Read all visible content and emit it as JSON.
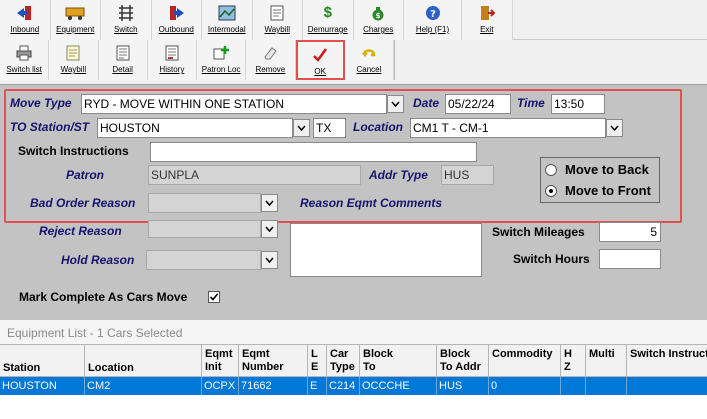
{
  "toolbar1": {
    "buttons": [
      {
        "label": "Inbound",
        "icon": "inbound-icon"
      },
      {
        "label": "Equipment",
        "icon": "equipment-icon"
      },
      {
        "label": "Switch",
        "icon": "switch-icon"
      },
      {
        "label": "Outbound",
        "icon": "outbound-icon"
      },
      {
        "label": "Intermodal",
        "icon": "intermodal-icon"
      },
      {
        "label": "Waybill",
        "icon": "waybill-icon"
      },
      {
        "label": "Demurrage",
        "icon": "dollar-icon"
      },
      {
        "label": "Charges",
        "icon": "money-bag-icon"
      },
      {
        "label": "Help (F1)",
        "icon": "help-icon"
      },
      {
        "label": "Exit",
        "icon": "exit-icon"
      }
    ]
  },
  "toolbar2": {
    "buttons": [
      {
        "label": "Switch list",
        "icon": "printer-icon"
      },
      {
        "label": "Waybill",
        "icon": "waybill-icon"
      },
      {
        "label": "Detail",
        "icon": "detail-icon"
      },
      {
        "label": "History",
        "icon": "history-icon"
      },
      {
        "label": "Patron Loc",
        "icon": "patron-loc-icon"
      },
      {
        "label": "Remove",
        "icon": "eraser-icon"
      },
      {
        "label": "OK",
        "icon": "checkmark-icon"
      },
      {
        "label": "Cancel",
        "icon": "cancel-icon"
      }
    ]
  },
  "form": {
    "move_type_label": "Move Type",
    "move_type_value": "RYD - MOVE WITHIN ONE STATION",
    "date_label": "Date",
    "date_value": "05/22/24",
    "time_label": "Time",
    "time_value": "13:50",
    "to_station_label": "TO Station/ST",
    "to_station_value": "HOUSTON",
    "state_value": "TX",
    "location_label": "Location",
    "location_value": "CM1 T - CM-1",
    "switch_instructions_label": "Switch Instructions",
    "switch_instructions_value": "",
    "patron_label": "Patron",
    "patron_value": "SUNPLA",
    "addr_type_label": "Addr Type",
    "addr_type_value": "HUS",
    "bad_order_reason_label": "Bad Order Reason",
    "reason_eqmt_comments_label": "Reason Eqmt Comments",
    "reject_reason_label": "Reject Reason",
    "hold_reason_label": "Hold Reason",
    "move_to_back_label": "Move to Back",
    "move_to_front_label": "Move to Front",
    "move_selected": "front",
    "switch_mileages_label": "Switch Mileages",
    "switch_mileages_value": "5",
    "switch_hours_label": "Switch Hours",
    "switch_hours_value": "",
    "mark_complete_label": "Mark Complete As Cars Move",
    "mark_complete_checked": true
  },
  "equipment_list": {
    "title": "Equipment List - 1 Cars Selected",
    "columns": [
      {
        "l1": "",
        "l2": "Station"
      },
      {
        "l1": "",
        "l2": "Location"
      },
      {
        "l1": "Eqmt",
        "l2": "Init"
      },
      {
        "l1": "Eqmt",
        "l2": "Number"
      },
      {
        "l1": "L",
        "l2": "E"
      },
      {
        "l1": "Car",
        "l2": "Type"
      },
      {
        "l1": "Block",
        "l2": "To"
      },
      {
        "l1": "Block",
        "l2": "To Addr"
      },
      {
        "l1": "Commodity",
        "l2": ""
      },
      {
        "l1": "H",
        "l2": "Z"
      },
      {
        "l1": "Multi",
        "l2": ""
      },
      {
        "l1": "Switch Instructions",
        "l2": ""
      }
    ],
    "rows": [
      [
        "HOUSTON",
        "CM2",
        "OCPX",
        "71662",
        "E",
        "C214",
        "OCCCHE",
        "HUS",
        "0",
        "",
        "",
        ""
      ]
    ]
  },
  "colors": {
    "form_background": "#c3c3c3",
    "label_blue": "#14146e",
    "selection_blue": "#0078d7",
    "highlight_red": "#e45050"
  }
}
